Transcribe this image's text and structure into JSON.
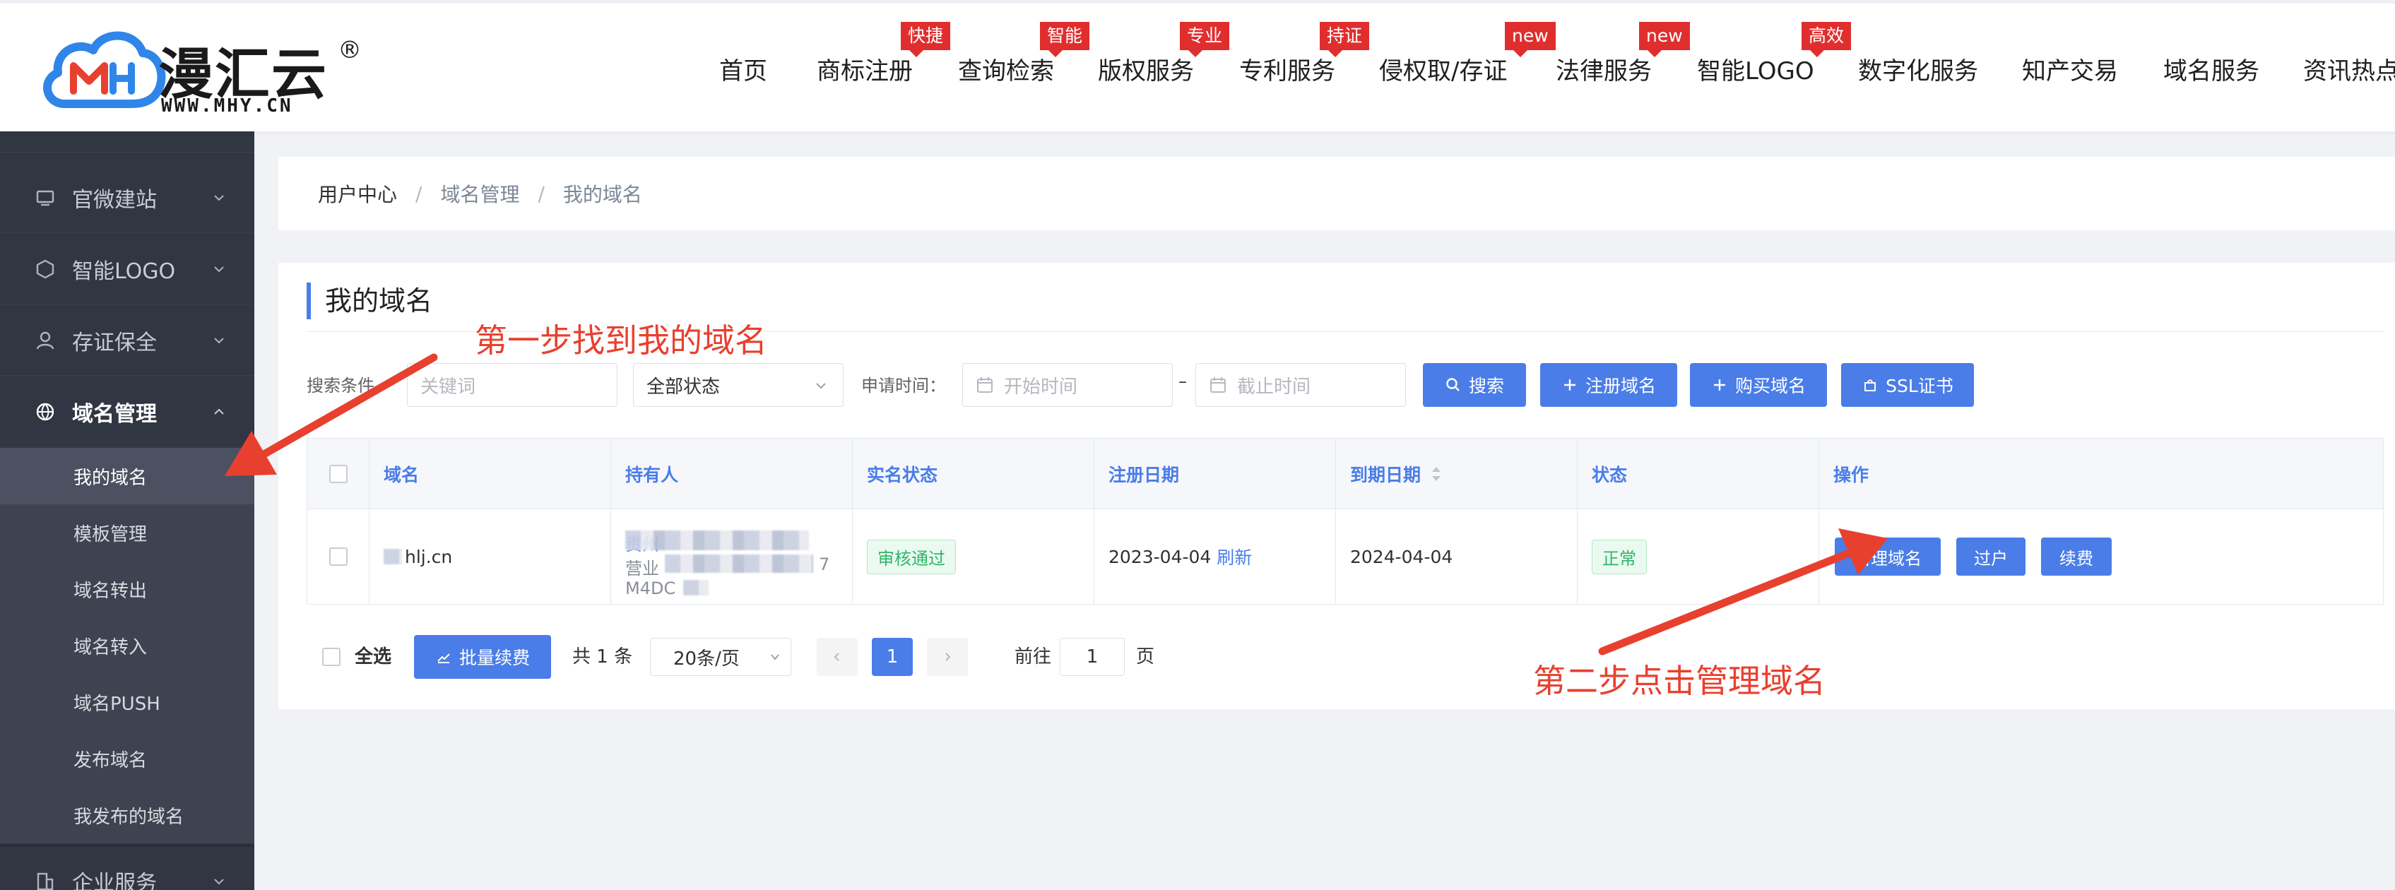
{
  "header": {
    "logo_name": "漫汇云",
    "logo_reg": "®",
    "logo_url": "WWW.MHY.CN",
    "nav": [
      {
        "label": "首页",
        "badge": ""
      },
      {
        "label": "商标注册",
        "badge": "快捷"
      },
      {
        "label": "查询检索",
        "badge": "智能"
      },
      {
        "label": "版权服务",
        "badge": "专业"
      },
      {
        "label": "专利服务",
        "badge": "持证"
      },
      {
        "label": "侵权取/存证",
        "badge": "new"
      },
      {
        "label": "法律服务",
        "badge": "new"
      },
      {
        "label": "智能LOGO",
        "badge": "高效"
      },
      {
        "label": "数字化服务",
        "badge": ""
      },
      {
        "label": "知产交易",
        "badge": ""
      },
      {
        "label": "域名服务",
        "badge": ""
      },
      {
        "label": "资讯热点",
        "badge": ""
      }
    ]
  },
  "sidebar": {
    "groups": [
      {
        "label": "官微建站"
      },
      {
        "label": "智能LOGO"
      },
      {
        "label": "存证保全"
      },
      {
        "label": "域名管理"
      },
      {
        "label": "企业服务"
      }
    ],
    "sub_items": [
      {
        "label": "我的域名"
      },
      {
        "label": "模板管理"
      },
      {
        "label": "域名转出"
      },
      {
        "label": "域名转入"
      },
      {
        "label": "域名PUSH"
      },
      {
        "label": "发布域名"
      },
      {
        "label": "我发布的域名"
      }
    ]
  },
  "breadcrumb": {
    "items": [
      "用户中心",
      "域名管理",
      "我的域名"
    ],
    "separator": "/"
  },
  "section_title": "我的域名",
  "filters": {
    "condition_label": "搜索条件",
    "keyword_placeholder": "关键词",
    "status_value": "全部状态",
    "apply_time_label": "申请时间：",
    "start_placeholder": "开始时间",
    "range_sep": "–",
    "end_placeholder": "截止时间",
    "search_button": "搜索",
    "register_button": "注册域名",
    "buy_button": "购买域名",
    "ssl_button": "SSL证书"
  },
  "table": {
    "columns": [
      "域名",
      "持有人",
      "实名状态",
      "注册日期",
      "到期日期",
      "状态",
      "操作"
    ],
    "rows": [
      {
        "domain": "hlj.cn",
        "holder_line1": "贵州",
        "holder_line2": "营业",
        "holder_line2_tail": "7",
        "holder_line3": "M4DC",
        "realname_status": "审核通过",
        "register_date": "2023-04-04",
        "refresh_link": "刷新",
        "expire_date": "2024-04-04",
        "status": "正常",
        "ops": [
          "管理域名",
          "过户",
          "续费"
        ]
      }
    ]
  },
  "footer": {
    "select_all": "全选",
    "batch_renew": "批量续费",
    "total": "共 1 条",
    "page_size": "20条/页",
    "current_page": "1",
    "goto_prefix": "前往",
    "goto_value": "1",
    "goto_suffix": "页"
  },
  "annotations": {
    "step1": "第一步找到我的域名",
    "step2": "第二步点击管理域名"
  },
  "colors": {
    "primary": "#4a7de8",
    "sidebar_bg": "#303642",
    "badge_red": "#e02e2e",
    "annotation_red": "#e8402f",
    "success_green": "#2fb667"
  }
}
